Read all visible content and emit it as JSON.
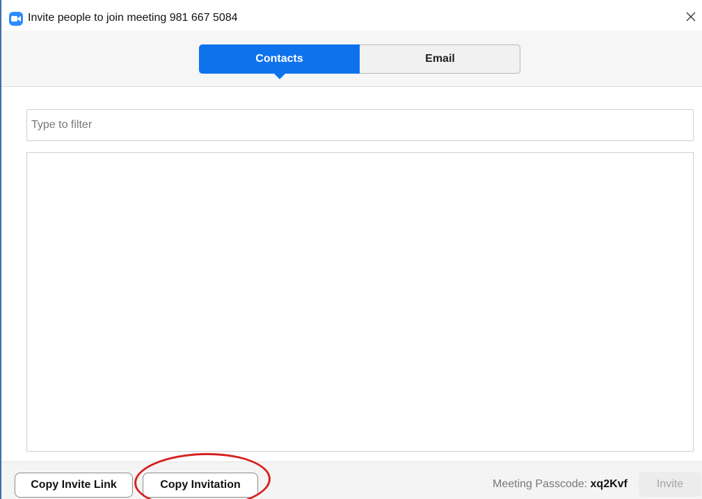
{
  "window": {
    "title": "Invite people to join meeting 981 667 5084",
    "app_icon": "zoom-camera-icon",
    "close_icon": "close-icon"
  },
  "tabs": [
    {
      "label": "Contacts",
      "active": true
    },
    {
      "label": "Email",
      "active": false
    }
  ],
  "filter": {
    "placeholder": "Type to filter",
    "value": ""
  },
  "contacts": [],
  "footer": {
    "copy_invite_link": "Copy Invite Link",
    "copy_invitation": "Copy Invitation",
    "passcode_label": "Meeting Passcode:",
    "passcode_value": "xq2Kvf",
    "invite_label": "Invite"
  },
  "colors": {
    "accent": "#0e72ed",
    "annotation": "#d6201f"
  }
}
